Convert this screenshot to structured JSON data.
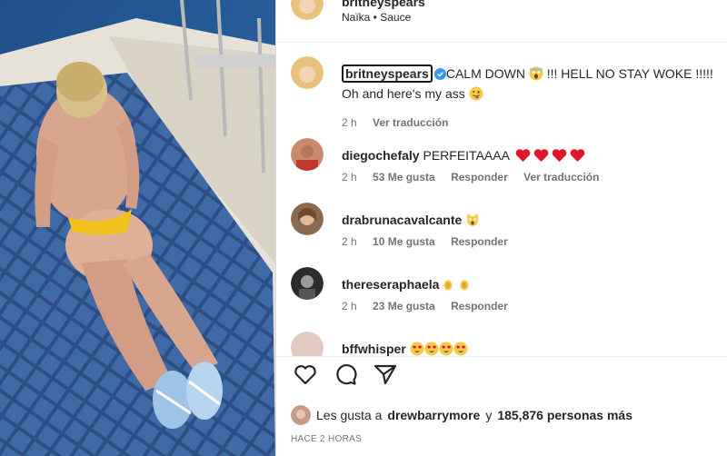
{
  "post": {
    "username": "britneyspears",
    "subtitle": "Naïka • Sauce",
    "likes_prefix": "Les gusta a",
    "likes_user": "drewbarrymore",
    "likes_middle": "y",
    "likes_count": "185,876 personas más",
    "timestamp": "HACE 2 HORAS"
  },
  "caption": {
    "username": "britneyspears",
    "text_line1": "CALM DOWN",
    "text_line1b": "!!! HELL NO STAY WOKE !!!!!",
    "text_line2": "Oh and here's my ass",
    "time": "2 h",
    "translate": "Ver traducción"
  },
  "comments": [
    {
      "username": "diegochefaly",
      "text": "PERFEITAAAA",
      "time": "2 h",
      "likes": "53 Me gusta",
      "reply": "Responder",
      "translate": "Ver traducción"
    },
    {
      "username": "drabrunacavalcante",
      "text": "",
      "time": "2 h",
      "likes": "10 Me gusta",
      "reply": "Responder"
    },
    {
      "username": "thereseraphaela",
      "text": "",
      "time": "2 h",
      "likes": "23 Me gusta",
      "reply": "Responder"
    },
    {
      "username": "bffwhisper",
      "text": ""
    }
  ],
  "icons": {
    "like": "heart-outline-icon",
    "comment": "comment-bubble-icon",
    "share": "paper-plane-icon",
    "verified": "verified-badge-icon"
  },
  "colors": {
    "verified": "#3897f0",
    "meta_text": "#737373",
    "heart_red": "#e0162b"
  }
}
